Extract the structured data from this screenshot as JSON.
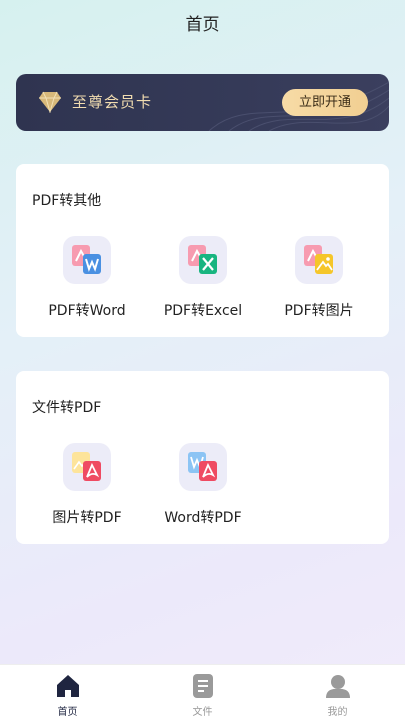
{
  "header": {
    "title": "首页"
  },
  "vip": {
    "label": "至尊会员卡",
    "button": "立即开通"
  },
  "sections": [
    {
      "title": "PDF转其他",
      "tools": [
        {
          "label": "PDF转Word",
          "icon": "pdf-to-word-icon"
        },
        {
          "label": "PDF转Excel",
          "icon": "pdf-to-excel-icon"
        },
        {
          "label": "PDF转图片",
          "icon": "pdf-to-image-icon"
        }
      ]
    },
    {
      "title": "文件转PDF",
      "tools": [
        {
          "label": "图片转PDF",
          "icon": "image-to-pdf-icon"
        },
        {
          "label": "Word转PDF",
          "icon": "word-to-pdf-icon"
        }
      ]
    }
  ],
  "tabs": [
    {
      "label": "首页",
      "icon": "home-icon",
      "active": true
    },
    {
      "label": "文件",
      "icon": "file-icon",
      "active": false
    },
    {
      "label": "我的",
      "icon": "profile-icon",
      "active": false
    }
  ],
  "colors": {
    "banner": "#2f3450",
    "gold": "#f1dcb0",
    "pdf_pink": "#f79bb0",
    "word_blue": "#4a90e2",
    "excel_green": "#18b580",
    "image_yellow": "#f5c62a",
    "pdf_red": "#ef4b62"
  }
}
